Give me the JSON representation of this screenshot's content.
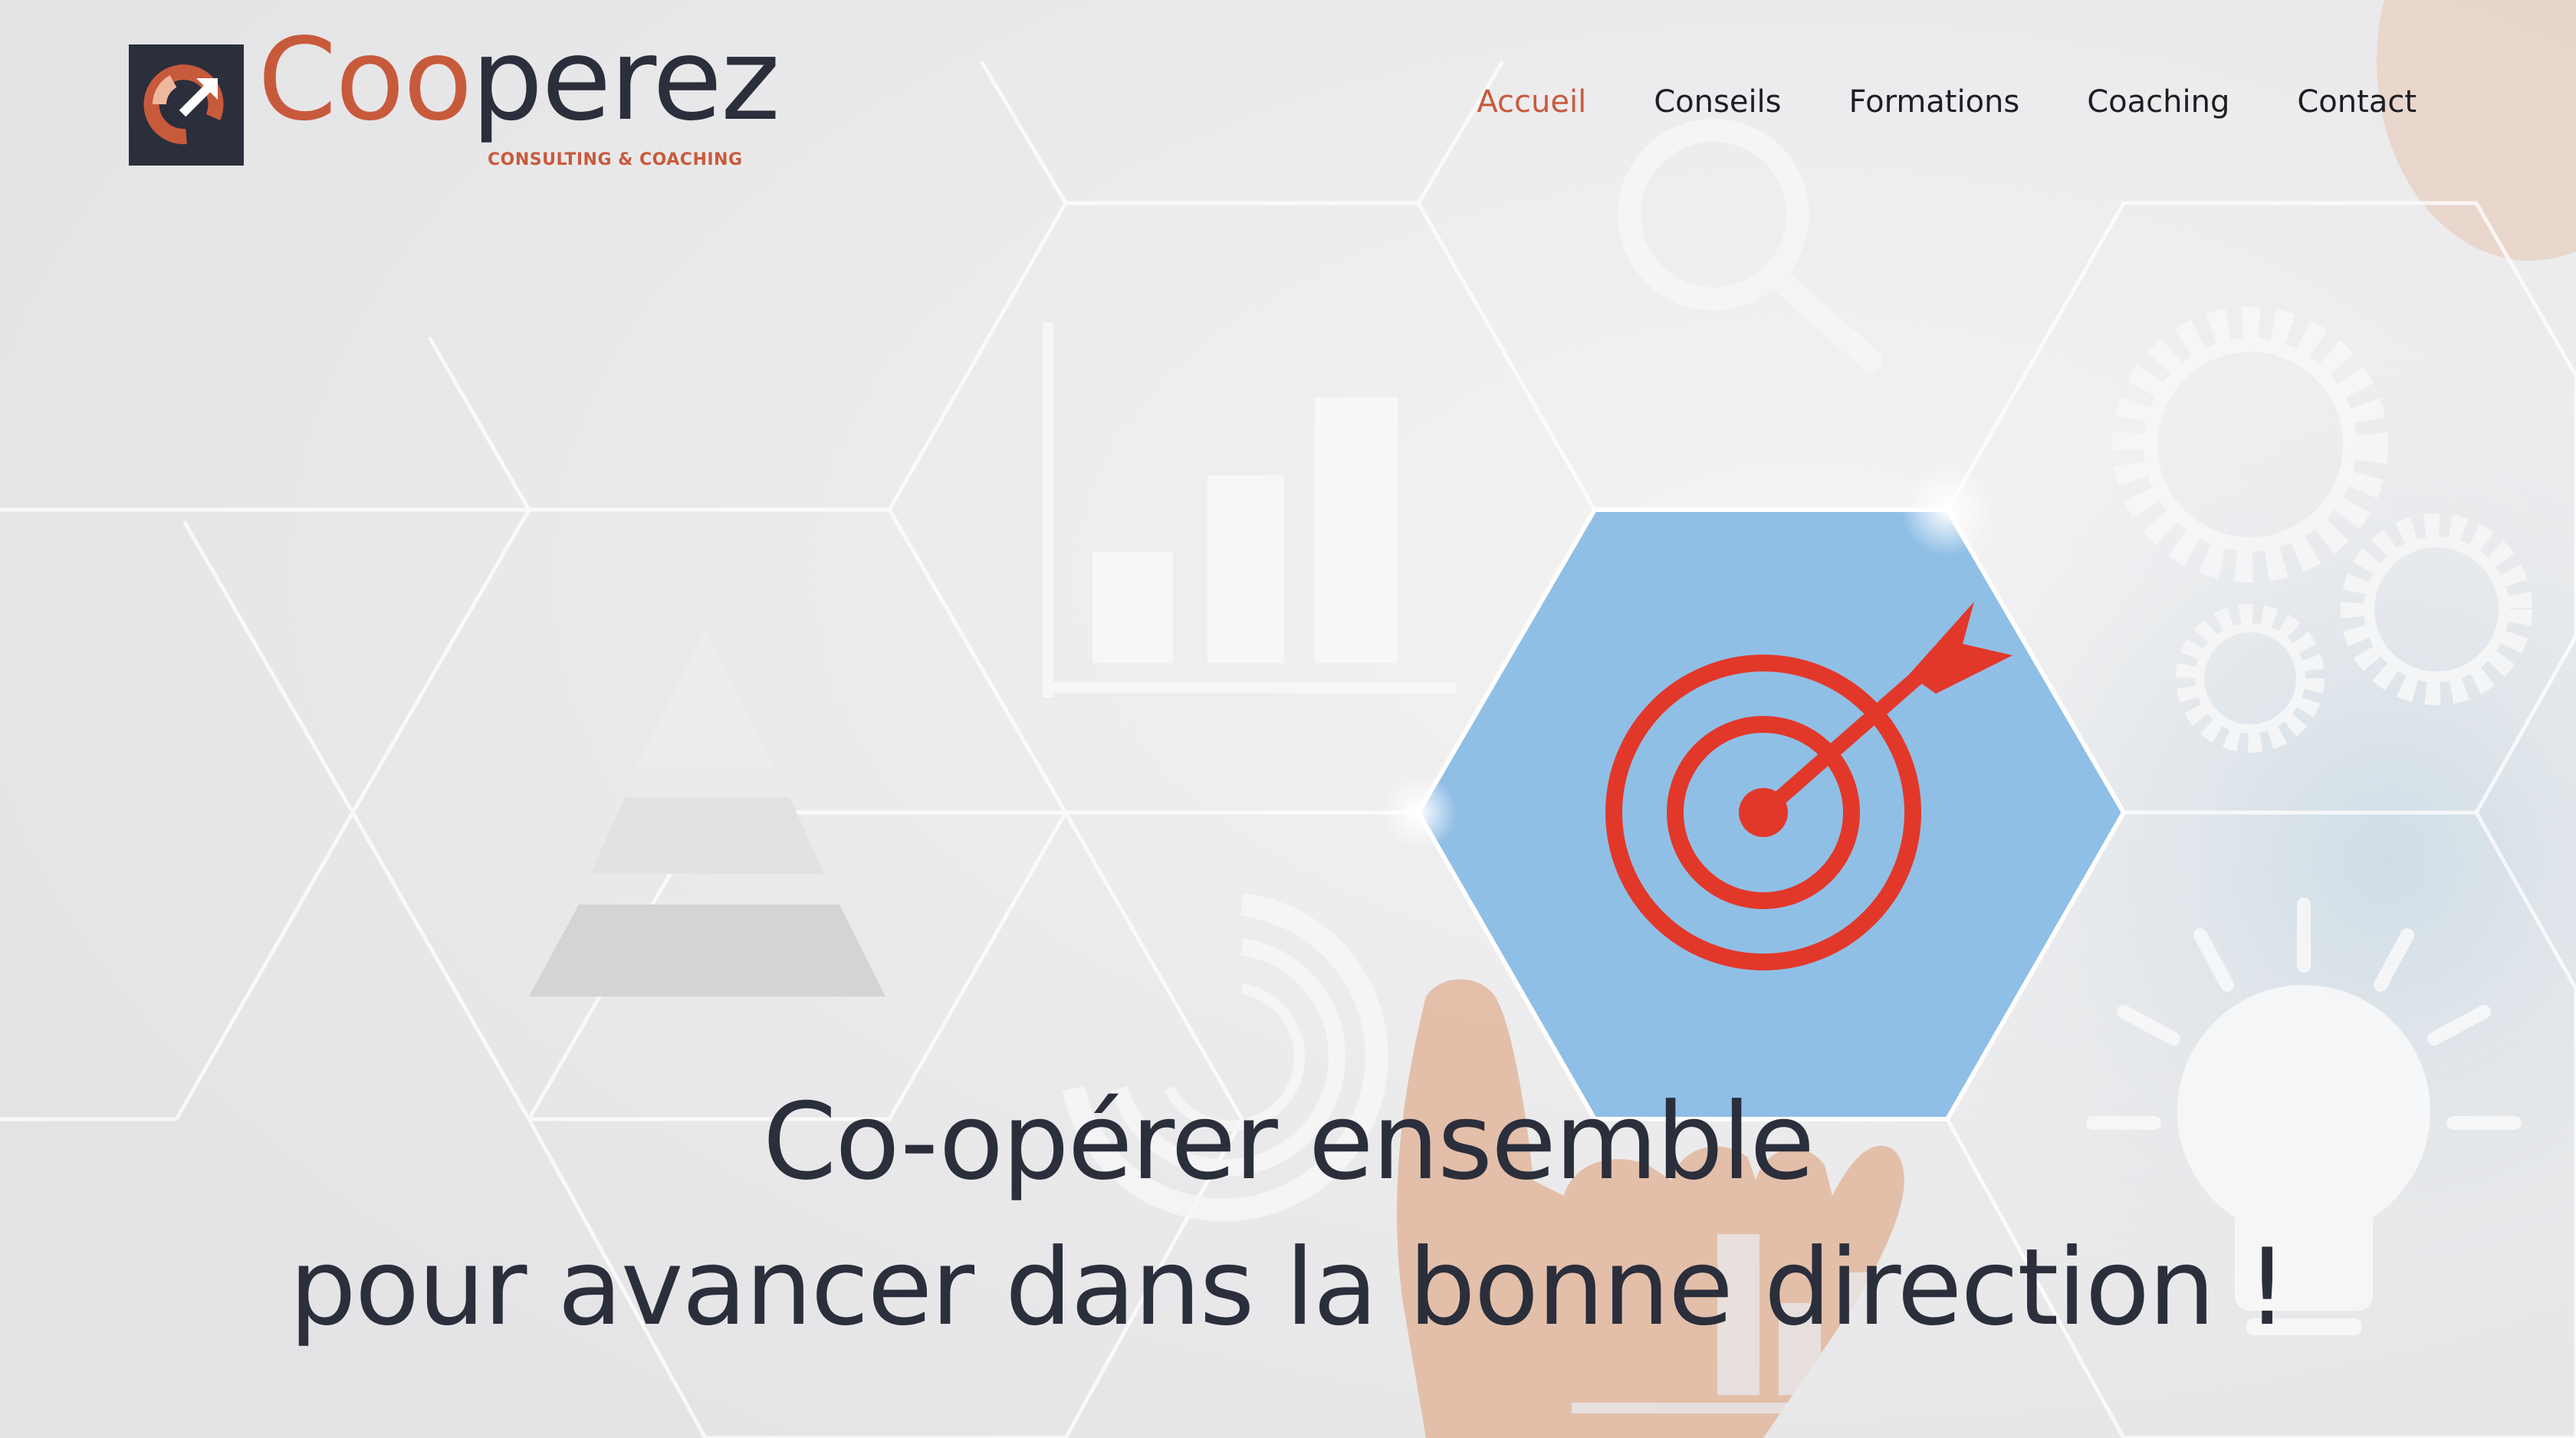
{
  "brand": {
    "name_part1": "Coo",
    "name_part2": "perez",
    "tagline": "CONSULTING & COACHING",
    "accent_color": "#c85a3c",
    "dark_color": "#2b2e3b"
  },
  "nav": {
    "items": [
      {
        "label": "Accueil",
        "active": true
      },
      {
        "label": "Conseils",
        "active": false
      },
      {
        "label": "Formations",
        "active": false
      },
      {
        "label": "Coaching",
        "active": false
      },
      {
        "label": "Contact",
        "active": false
      }
    ]
  },
  "hero": {
    "headline_line1": "Co-opérer ensemble",
    "headline_line2": "pour avancer dans la bonne direction !",
    "icons": [
      "magnifier-icon",
      "bar-chart-icon",
      "pyramid-icon",
      "target-icon",
      "gears-icon",
      "lightbulb-icon",
      "gauge-icon",
      "pointing-hand"
    ],
    "highlight_color": "#8bbde6",
    "target_color": "#e2382a"
  }
}
